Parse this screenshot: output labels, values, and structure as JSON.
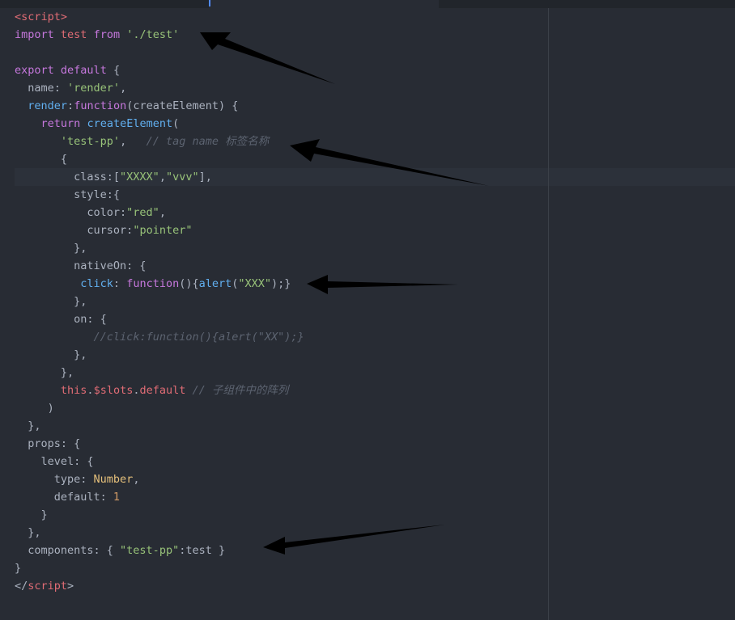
{
  "editor": {
    "colors": {
      "background": "#282c34",
      "keyword": "#c678dd",
      "string": "#98c379",
      "function": "#61afef",
      "tag": "#e06c75",
      "number": "#d19a66",
      "type": "#e5c07b",
      "comment": "#5c6370"
    },
    "lines": [
      [
        [
          "t",
          "<script>"
        ]
      ],
      [
        [
          "k",
          "import"
        ],
        [
          "p",
          " "
        ],
        [
          "t",
          "test"
        ],
        [
          "p",
          " "
        ],
        [
          "k",
          "from"
        ],
        [
          "p",
          " "
        ],
        [
          "s",
          "'./test'"
        ]
      ],
      [],
      [
        [
          "k",
          "export"
        ],
        [
          "p",
          " "
        ],
        [
          "k",
          "default"
        ],
        [
          "p",
          " {"
        ]
      ],
      [
        [
          "p",
          "  name: "
        ],
        [
          "s",
          "'render'"
        ],
        [
          "p",
          ","
        ]
      ],
      [
        [
          "p",
          "  "
        ],
        [
          "f",
          "render"
        ],
        [
          "p",
          ":"
        ],
        [
          "k",
          "function"
        ],
        [
          "p",
          "(createElement) {"
        ]
      ],
      [
        [
          "p",
          "    "
        ],
        [
          "k",
          "return"
        ],
        [
          "p",
          " "
        ],
        [
          "f",
          "createElement"
        ],
        [
          "p",
          "("
        ]
      ],
      [
        [
          "p",
          "       "
        ],
        [
          "s",
          "'test-pp'"
        ],
        [
          "p",
          ",   "
        ],
        [
          "c",
          "// tag name 标签名称"
        ]
      ],
      [
        [
          "p",
          "       {"
        ]
      ],
      [
        [
          "p",
          "         class:["
        ],
        [
          "s",
          "\"XXXX\""
        ],
        [
          "p",
          ","
        ],
        [
          "s",
          "\"vvv\""
        ],
        [
          "p",
          "],"
        ]
      ],
      [
        [
          "p",
          "         style:{"
        ]
      ],
      [
        [
          "p",
          "           color:"
        ],
        [
          "s",
          "\"red\""
        ],
        [
          "p",
          ","
        ]
      ],
      [
        [
          "p",
          "           cursor:"
        ],
        [
          "s",
          "\"pointer\""
        ]
      ],
      [
        [
          "p",
          "         },"
        ]
      ],
      [
        [
          "p",
          "         nativeOn: {"
        ]
      ],
      [
        [
          "p",
          "          "
        ],
        [
          "f",
          "click"
        ],
        [
          "p",
          ": "
        ],
        [
          "k",
          "function"
        ],
        [
          "p",
          "(){"
        ],
        [
          "f",
          "alert"
        ],
        [
          "p",
          "("
        ],
        [
          "s",
          "\"XXX\""
        ],
        [
          "p",
          ");}"
        ]
      ],
      [
        [
          "p",
          "         },"
        ]
      ],
      [
        [
          "p",
          "         on: {"
        ]
      ],
      [
        [
          "p",
          "            "
        ],
        [
          "c",
          "//click:function(){alert(\"XX\");}"
        ]
      ],
      [
        [
          "p",
          "         },"
        ]
      ],
      [
        [
          "p",
          "       },"
        ]
      ],
      [
        [
          "p",
          "       "
        ],
        [
          "t",
          "this"
        ],
        [
          "p",
          "."
        ],
        [
          "t",
          "$slots"
        ],
        [
          "p",
          "."
        ],
        [
          "t",
          "default"
        ],
        [
          "p",
          " "
        ],
        [
          "c",
          "// 子组件中的阵列"
        ]
      ],
      [
        [
          "p",
          "     )"
        ]
      ],
      [
        [
          "p",
          "  },"
        ]
      ],
      [
        [
          "p",
          "  props: {"
        ]
      ],
      [
        [
          "p",
          "    level: {"
        ]
      ],
      [
        [
          "p",
          "      type: "
        ],
        [
          "y",
          "Number"
        ],
        [
          "p",
          ","
        ]
      ],
      [
        [
          "p",
          "      default: "
        ],
        [
          "n",
          "1"
        ]
      ],
      [
        [
          "p",
          "    }"
        ]
      ],
      [
        [
          "p",
          "  },"
        ]
      ],
      [
        [
          "p",
          "  components: { "
        ],
        [
          "s",
          "\"test-pp\""
        ],
        [
          "p",
          ":test }"
        ]
      ],
      [
        [
          "p",
          "}"
        ]
      ],
      [
        [
          "p",
          "</"
        ],
        [
          "t",
          "script"
        ],
        [
          "p",
          ">"
        ]
      ]
    ]
  }
}
